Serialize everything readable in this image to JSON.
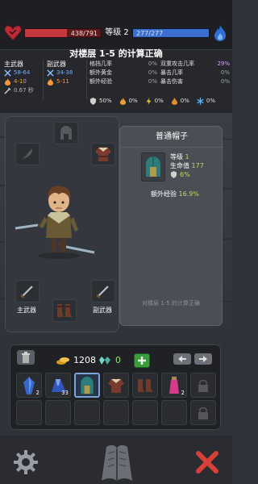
{
  "header": {
    "hp_text": "438/791",
    "hp_fraction": 0.554,
    "level_label": "等级 2",
    "mp_text": "277/277",
    "mp_fraction": 1.0
  },
  "stats": {
    "title": "对楼层 1-5 的计算正确",
    "main_weapon": {
      "label": "主武器",
      "damage": "58-64",
      "fire": "4-10",
      "speed": "0.67 秒"
    },
    "off_weapon": {
      "label": "副武器",
      "damage": "34-38",
      "fire": "5-11"
    },
    "mid_table": [
      {
        "label": "格挡几率",
        "value": "0%"
      },
      {
        "label": "额外黄金",
        "value": "0%"
      },
      {
        "label": "额外经验",
        "value": "0%"
      }
    ],
    "right_table": [
      {
        "label": "双重攻击几率",
        "value": "29%"
      },
      {
        "label": "暴击几率",
        "value": "0%"
      },
      {
        "label": "暴击伤害",
        "value": "0%"
      }
    ],
    "resists": [
      "50%",
      "0%",
      "0%",
      "0%",
      "0%"
    ]
  },
  "equipment": {
    "main_label": "主武器",
    "off_label": "副武器"
  },
  "tooltip": {
    "title": "普通帽子",
    "level_label": "等级",
    "level_value": "1",
    "hp_label": "生命值",
    "hp_value": "177",
    "armor_value": "6%",
    "extra_label": "额外经验",
    "extra_value": "16.9%",
    "footer": "对楼层 1-5 的计算正确"
  },
  "inventory": {
    "gold": "1208",
    "gems": "0",
    "slots": [
      {
        "icon": "blue-crystal-icon",
        "count": "2"
      },
      {
        "icon": "blue-cape-icon",
        "count": "33"
      },
      {
        "icon": "helmet-icon",
        "count": "",
        "selected": true
      },
      {
        "icon": "tunic-icon",
        "count": ""
      },
      {
        "icon": "boots-icon",
        "count": ""
      },
      {
        "icon": "potion-icon",
        "count": "2"
      },
      {
        "icon": "lock-icon",
        "count": ""
      },
      {
        "icon": "empty-slot",
        "count": ""
      },
      {
        "icon": "empty-slot",
        "count": ""
      },
      {
        "icon": "empty-slot",
        "count": ""
      },
      {
        "icon": "empty-slot",
        "count": ""
      },
      {
        "icon": "empty-slot",
        "count": ""
      },
      {
        "icon": "empty-slot",
        "count": ""
      },
      {
        "icon": "lock-icon",
        "count": ""
      }
    ]
  },
  "colors": {
    "hp": "#c6383e",
    "mp": "#3b6fcf",
    "fire": "#f29a38",
    "damage": "#6fb0ff",
    "positive": "#c2d76a"
  }
}
